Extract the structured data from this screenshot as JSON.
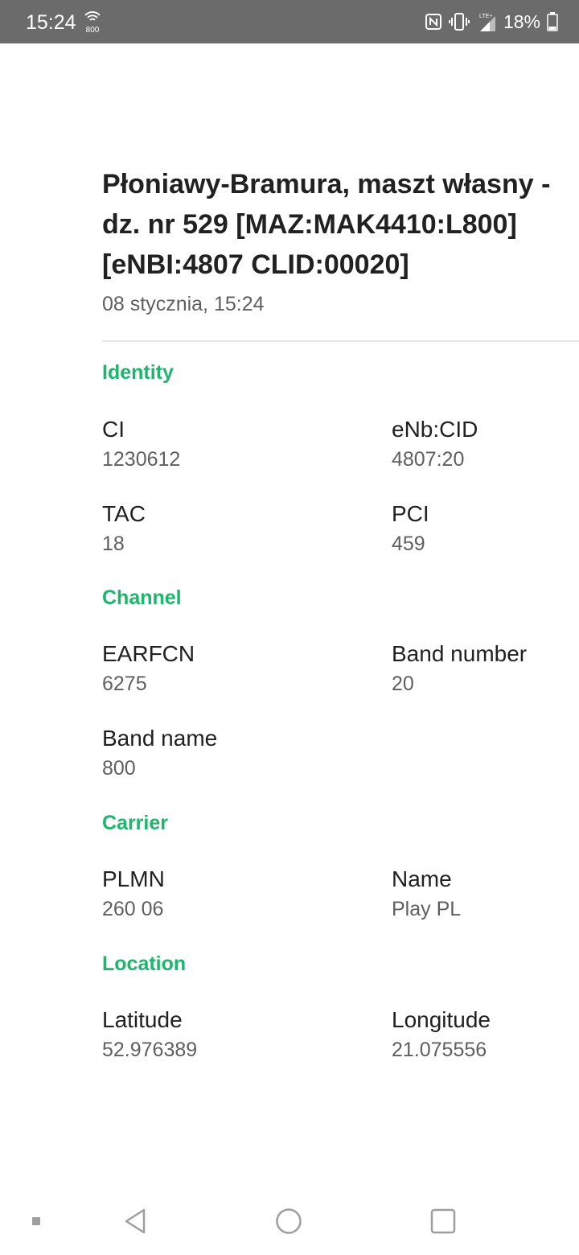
{
  "status_bar": {
    "time": "15:24",
    "band_label": "800",
    "battery_percent": "18%",
    "network_type": "LTE+",
    "icons": [
      "band-800-icon",
      "nfc-icon",
      "vibrate-icon",
      "signal-icon",
      "battery-icon"
    ]
  },
  "cell": {
    "title": "Płoniawy-Bramura, maszt własny - dz. nr 529 [MAZ:MAK4410:L800] [eNBI:4807 CLID:00020]",
    "timestamp": "08 stycznia, 15:24"
  },
  "sections": {
    "identity": {
      "header": "Identity",
      "ci_label": "CI",
      "ci_value": "1230612",
      "enb_cid_label": "eNb:CID",
      "enb_cid_value": "4807:20",
      "tac_label": "TAC",
      "tac_value": "18",
      "pci_label": "PCI",
      "pci_value": "459"
    },
    "channel": {
      "header": "Channel",
      "earfcn_label": "EARFCN",
      "earfcn_value": "6275",
      "band_number_label": "Band number",
      "band_number_value": "20",
      "band_name_label": "Band name",
      "band_name_value": "800"
    },
    "carrier": {
      "header": "Carrier",
      "plmn_label": "PLMN",
      "plmn_value": "260 06",
      "name_label": "Name",
      "name_value": "Play PL"
    },
    "location": {
      "header": "Location",
      "latitude_label": "Latitude",
      "latitude_value": "52.976389",
      "longitude_label": "Longitude",
      "longitude_value": "21.075556"
    }
  },
  "nav_bar": {
    "icons": [
      "menu-dot-icon",
      "back-icon",
      "home-icon",
      "recents-icon"
    ]
  },
  "colors": {
    "accent": "#1db66c",
    "status_bar": "#6b6b6b"
  }
}
